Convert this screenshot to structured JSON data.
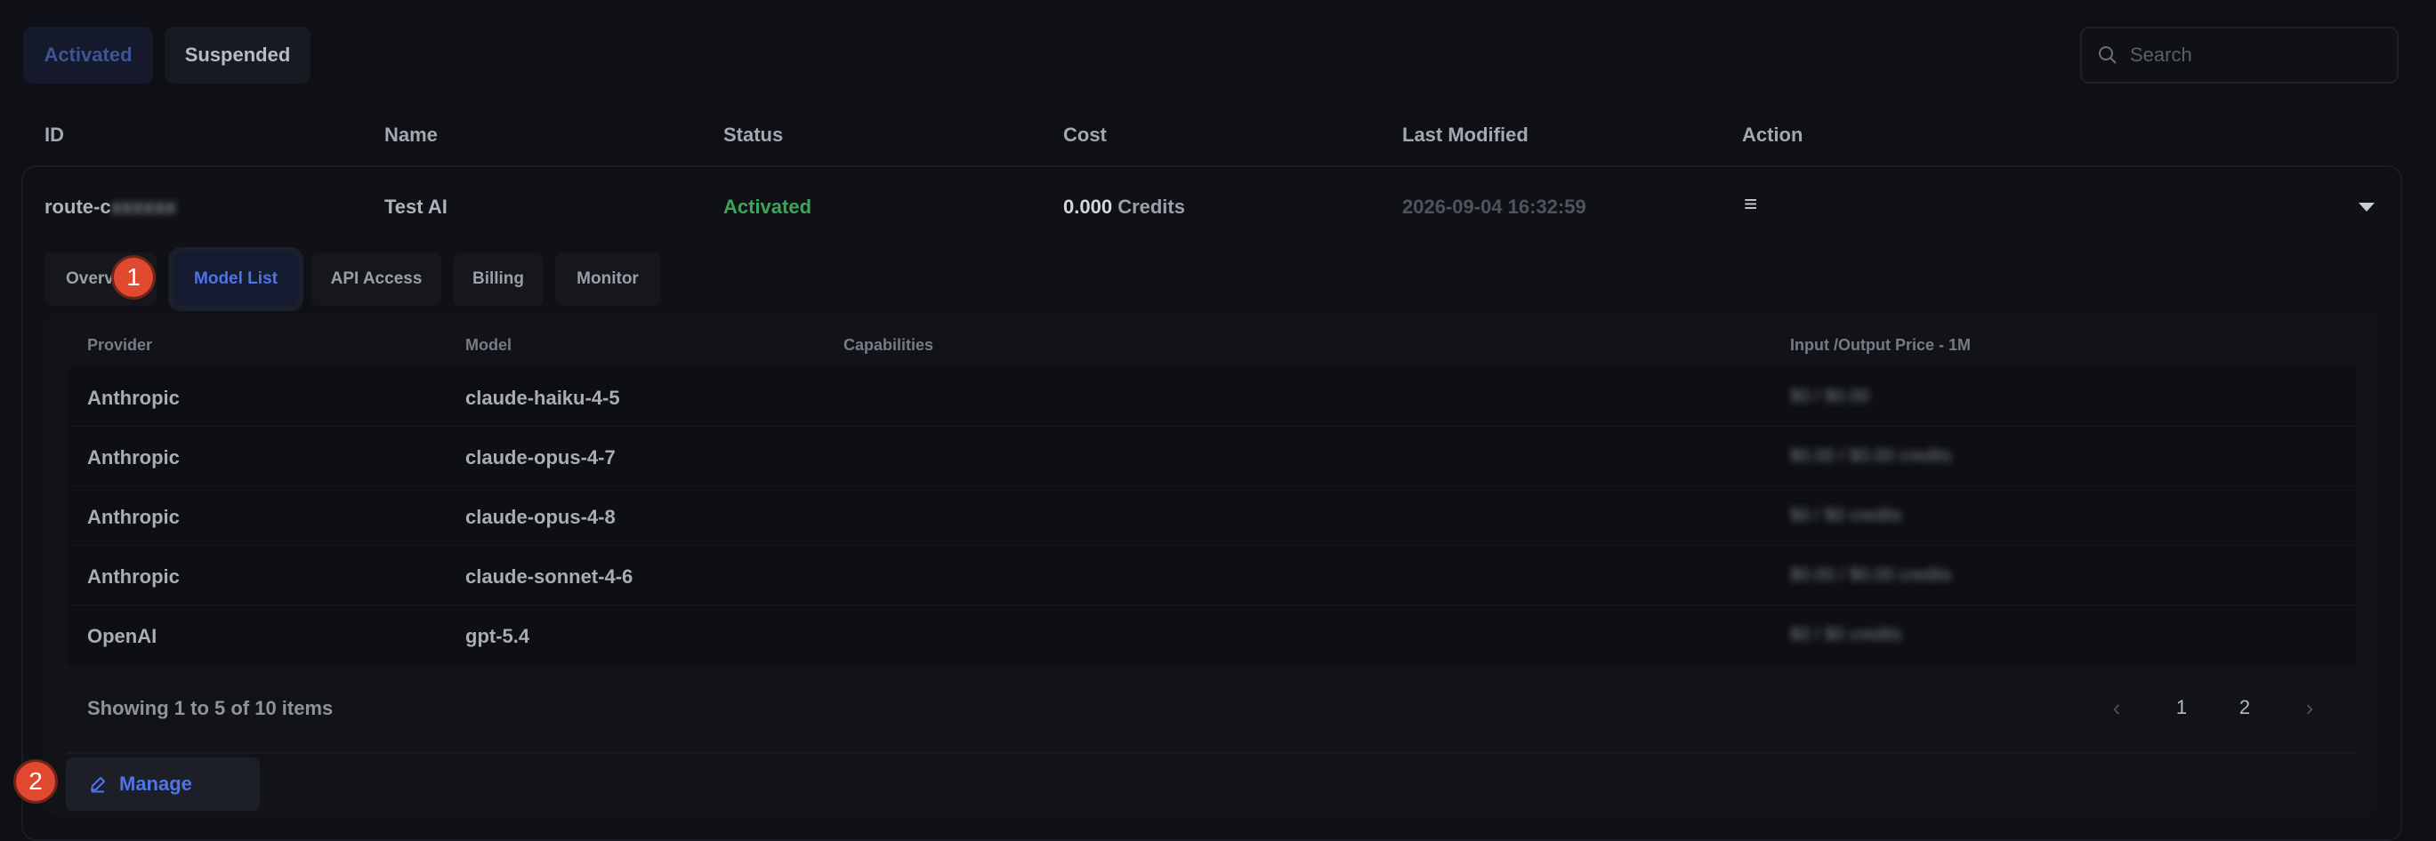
{
  "filter_tabs": [
    {
      "label": "Activated"
    },
    {
      "label": "Suspended"
    }
  ],
  "search": {
    "placeholder": "Search"
  },
  "columns": [
    "ID",
    "Name",
    "Status",
    "Cost",
    "Last Modified",
    "Action"
  ],
  "route": {
    "id_prefix": "route-c",
    "id_masked": "xxxxxx",
    "name": "Test AI",
    "status": "Activated",
    "cost_value": "0.000",
    "cost_unit": "Credits",
    "last_modified": "2026-09-04 16:32:59",
    "action_icon": "≡"
  },
  "sub_tabs": [
    {
      "label": "Overv"
    },
    {
      "label": "Model List"
    },
    {
      "label": "API Access"
    },
    {
      "label": "Billing"
    },
    {
      "label": "Monitor"
    }
  ],
  "model_table": {
    "headers": [
      "Provider",
      "Model",
      "Capabilities",
      "Input /Output Price - 1M"
    ],
    "rows": [
      {
        "provider": "Anthropic",
        "model": "claude-haiku-4-5",
        "price": "$0 / $0.00"
      },
      {
        "provider": "Anthropic",
        "model": "claude-opus-4-7",
        "price": "$0.00 / $0.00 credits"
      },
      {
        "provider": "Anthropic",
        "model": "claude-opus-4-8",
        "price": "$0 / $0 credits"
      },
      {
        "provider": "Anthropic",
        "model": "claude-sonnet-4-6",
        "price": "$0.00 / $0.00 credits"
      },
      {
        "provider": "OpenAI",
        "model": "gpt-5.4",
        "price": "$0 / $0 credits"
      }
    ]
  },
  "pagination": {
    "summary": "Showing 1 to 5 of 10 items",
    "pages": [
      "1",
      "2"
    ],
    "prev_icon": "‹",
    "next_icon": "›"
  },
  "manage_button": {
    "label": "Manage"
  },
  "annotations": {
    "badge1": "1",
    "badge2": "2"
  }
}
